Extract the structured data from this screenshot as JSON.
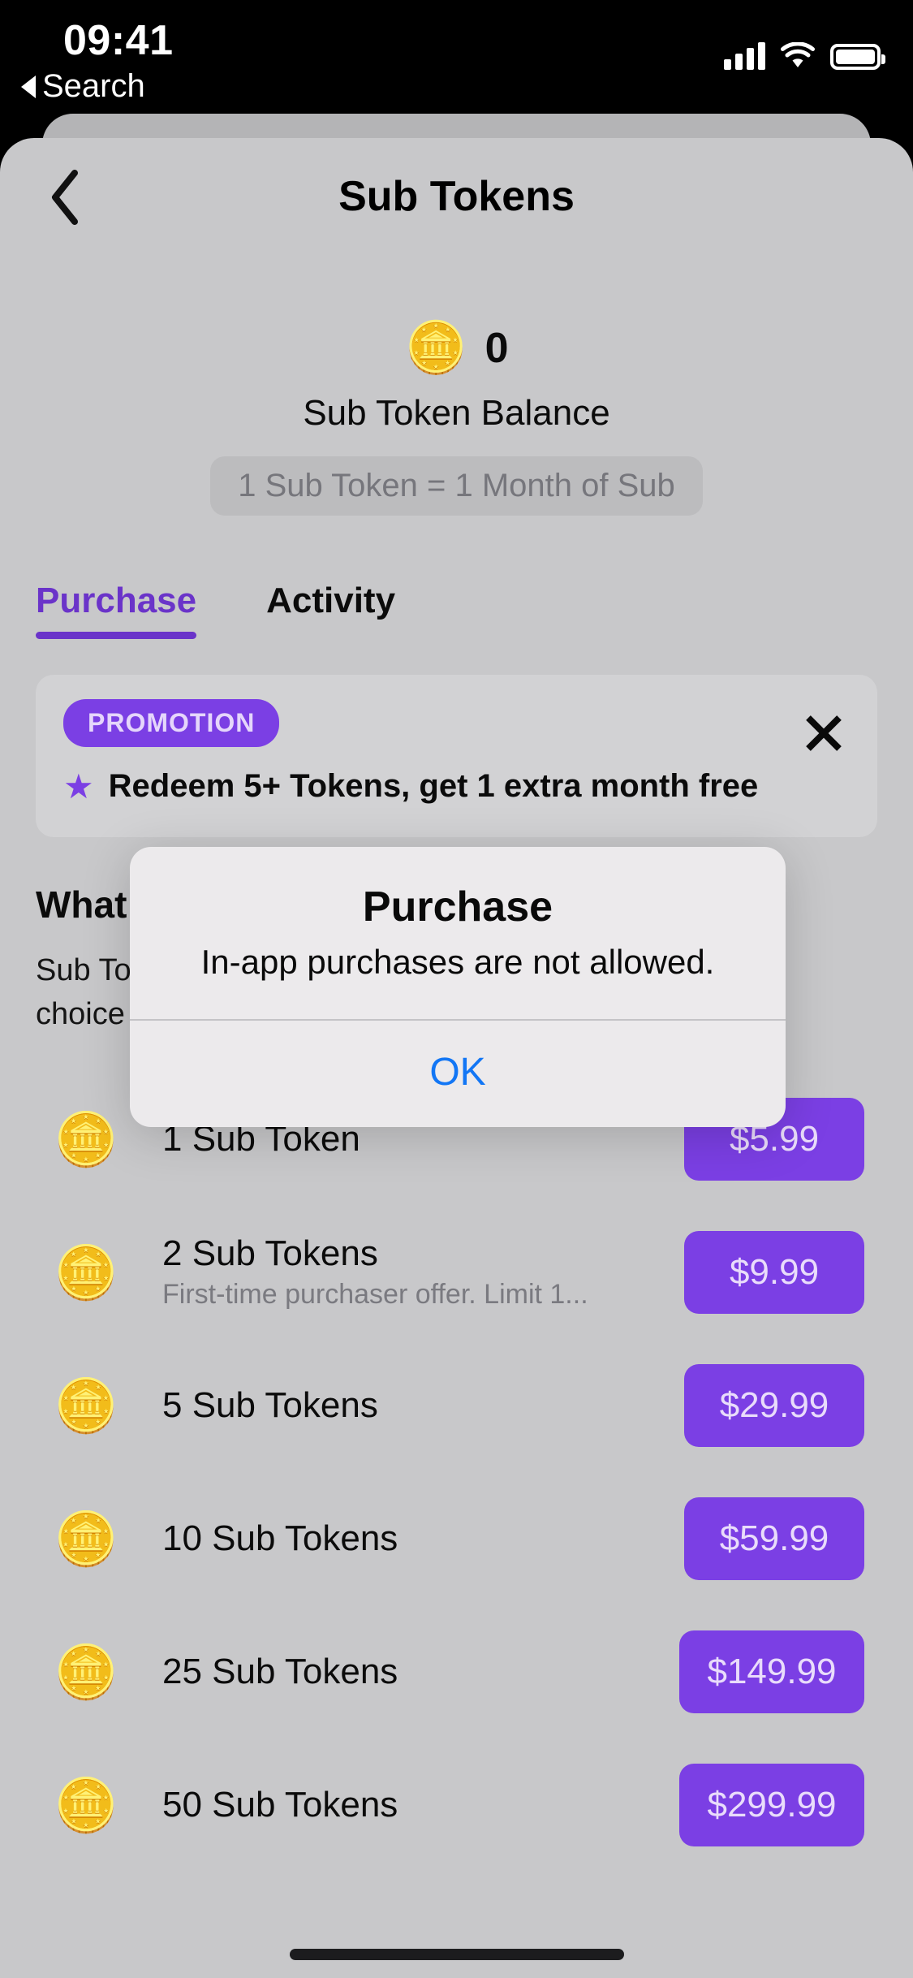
{
  "status_bar": {
    "time": "09:41",
    "back_label": "Search",
    "cellular_icon": "signal-bars-icon",
    "wifi_icon": "wifi-icon",
    "battery_icon": "battery-icon"
  },
  "nav": {
    "back_icon": "chevron-left-icon",
    "title": "Sub Tokens"
  },
  "balance": {
    "coin_icon": "🪙",
    "count": "0",
    "label": "Sub Token Balance",
    "rate_pill": "1 Sub Token = 1 Month of Sub"
  },
  "tabs": [
    {
      "label": "Purchase",
      "active": true
    },
    {
      "label": "Activity",
      "active": false
    }
  ],
  "promotion": {
    "badge": "PROMOTION",
    "star_icon": "★",
    "text": "Redeem 5+ Tokens, get 1 extra month free",
    "close_icon": "close-icon"
  },
  "info": {
    "heading": "What",
    "paragraph_line1": "Sub To",
    "paragraph_line2": "choice",
    "paragraph_tail": "."
  },
  "products": [
    {
      "icon": "🪙",
      "title": "1 Sub Token",
      "subtitle": "",
      "price": "$5.99"
    },
    {
      "icon": "🪙",
      "title": "2 Sub Tokens",
      "subtitle": "First-time purchaser offer. Limit 1...",
      "price": "$9.99"
    },
    {
      "icon": "🪙",
      "title": "5 Sub Tokens",
      "subtitle": "",
      "price": "$29.99"
    },
    {
      "icon": "🪙",
      "title": "10 Sub Tokens",
      "subtitle": "",
      "price": "$59.99"
    },
    {
      "icon": "🪙",
      "title": "25 Sub Tokens",
      "subtitle": "",
      "price": "$149.99"
    },
    {
      "icon": "🪙",
      "title": "50 Sub Tokens",
      "subtitle": "",
      "price": "$299.99"
    }
  ],
  "alert": {
    "title": "Purchase",
    "message": "In-app purchases are not allowed.",
    "ok_label": "OK"
  },
  "colors": {
    "accent_purple": "#7b3fe4",
    "tab_purple": "#6a33c9",
    "sheet_bg": "#c8c8ca",
    "card_bg": "#d2d2d4",
    "alert_link_blue": "#1276f5"
  }
}
